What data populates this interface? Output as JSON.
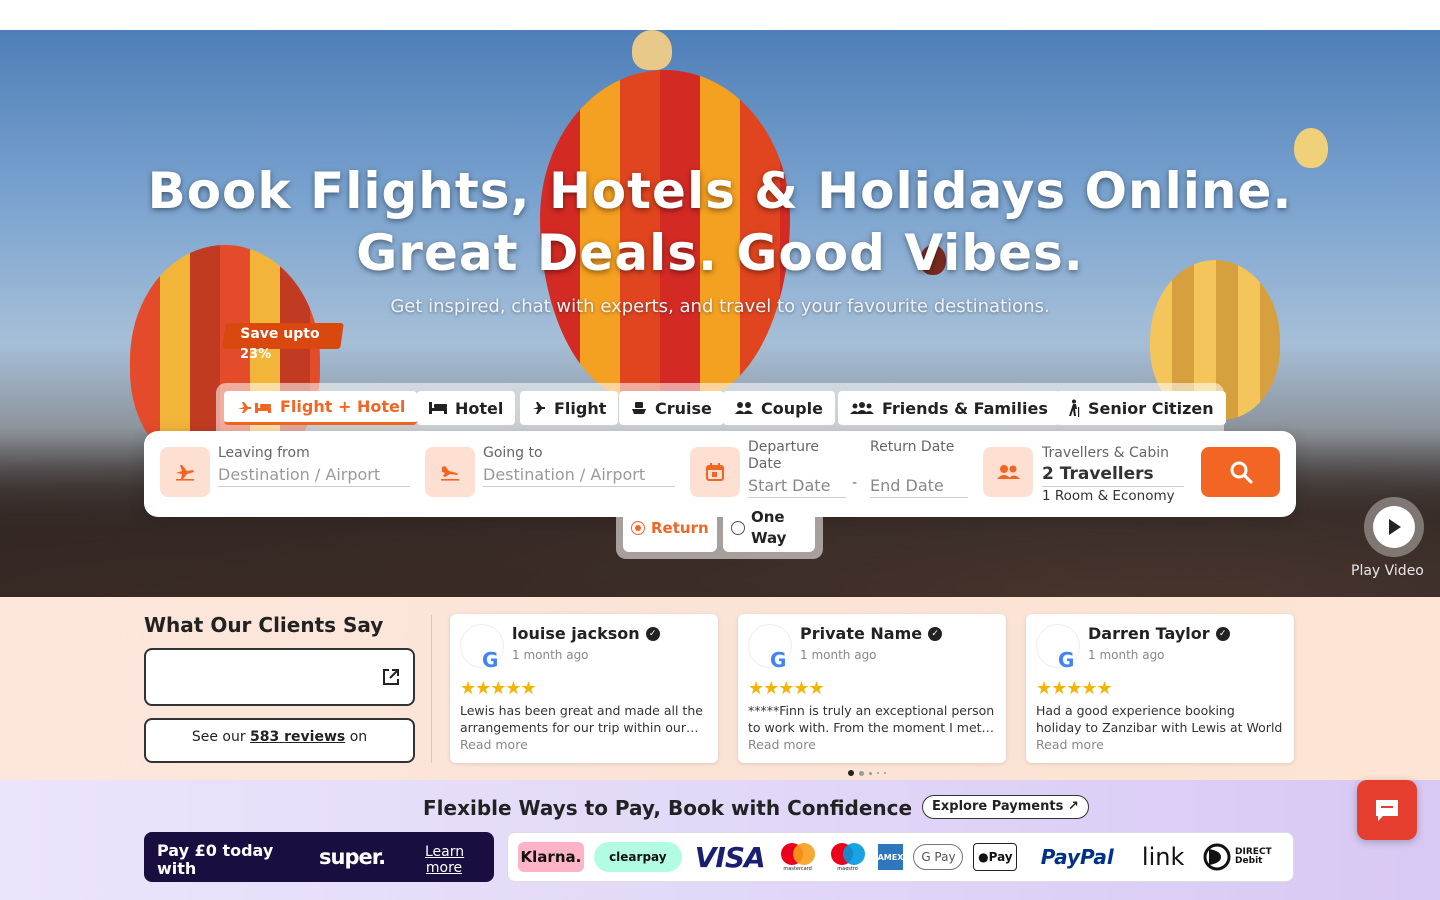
{
  "hero": {
    "title_line1": "Book Flights, Hotels & Holidays Online.",
    "title_line2": "Great Deals. Good Vibes.",
    "subtitle": "Get inspired, chat with experts, and travel to your favourite destinations."
  },
  "promo": {
    "save_label": "Save upto",
    "save_pct": "23%"
  },
  "tabs": [
    {
      "label": "Flight + Hotel",
      "active": true,
      "icon": "plane-bed-icon"
    },
    {
      "label": "Hotel",
      "icon": "bed-icon"
    },
    {
      "label": "Flight",
      "icon": "plane-icon"
    },
    {
      "label": "Cruise",
      "icon": "ship-icon"
    },
    {
      "label": "Couple",
      "icon": "couple-icon"
    },
    {
      "label": "Friends & Families",
      "icon": "group-icon"
    },
    {
      "label": "Senior Citizen",
      "icon": "walking-icon"
    }
  ],
  "search": {
    "leaving_label": "Leaving from",
    "leaving_placeholder": "Destination / Airport",
    "going_label": "Going to",
    "going_placeholder": "Destination / Airport",
    "departure_label": "Departure Date",
    "departure_placeholder": "Start Date",
    "return_label": "Return Date",
    "return_placeholder": "End Date",
    "separator": "-",
    "travellers_label": "Travellers & Cabin",
    "travellers_value": "2 Travellers",
    "travellers_sub": "1 Room & Economy"
  },
  "trip_type": {
    "return_label": "Return",
    "oneway_label": "One Way",
    "selected": "return"
  },
  "video": {
    "label": "Play Video"
  },
  "reviews": {
    "title": "What Our Clients Say",
    "count_prefix": "See our",
    "count": "583",
    "count_suffix": "reviews",
    "count_on": "on",
    "cards": [
      {
        "name": "louise jackson",
        "date": "1 month ago",
        "text": "Lewis has been great and made all the arrangements for our trip within our…",
        "more": "Read more"
      },
      {
        "name": "Private Name",
        "date": "1 month ago",
        "text": "*****Finn is truly an exceptional person to work with. From the moment I met…",
        "more": "Read more"
      },
      {
        "name": "Darren Taylor",
        "date": "1 month ago",
        "text": "Had a good experience booking holiday to Zanzibar with Lewis at World Holida…",
        "more": "Read more"
      }
    ],
    "stars": "★★★★★"
  },
  "payments": {
    "title": "Flexible Ways to Pay, Book with Confidence",
    "explore_label": "Explore Payments ↗",
    "super_text": "Pay £0 today with",
    "super_logo": "super.",
    "learn_more": "Learn more",
    "logos": [
      "Klarna.",
      "clearpay",
      "VISA",
      "mastercard",
      "maestro",
      "AMEX",
      "G Pay",
      "Pay",
      "PayPal",
      "link",
      "DIRECT Debit"
    ]
  },
  "colors": {
    "accent": "#f26522",
    "chat": "#e53e2e"
  }
}
